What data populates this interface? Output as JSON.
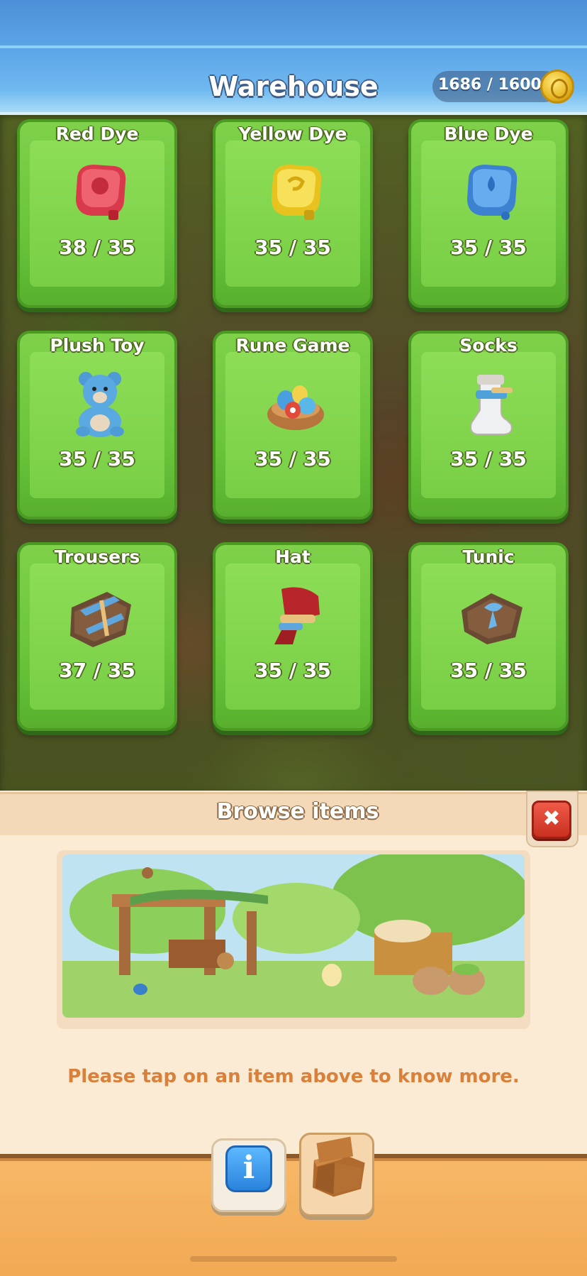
{
  "header": {
    "title": "Warehouse",
    "capacity": "1686 / 16000"
  },
  "items": [
    {
      "name": "Red Dye",
      "count": "38 / 35",
      "icon": "red-dye-icon",
      "color": "#e04a5a"
    },
    {
      "name": "Yellow Dye",
      "count": "35 / 35",
      "icon": "yellow-dye-icon",
      "color": "#f2d232"
    },
    {
      "name": "Blue Dye",
      "count": "35 / 35",
      "icon": "blue-dye-icon",
      "color": "#4a93dd"
    },
    {
      "name": "Plush Toy",
      "count": "35 / 35",
      "icon": "teddy-bear-icon",
      "color": "#5aa9e0"
    },
    {
      "name": "Rune Game",
      "count": "35 / 35",
      "icon": "rune-game-icon",
      "color": "#c98a4d"
    },
    {
      "name": "Socks",
      "count": "35 / 35",
      "icon": "sock-icon",
      "color": "#eef0f2"
    },
    {
      "name": "Trousers",
      "count": "37 / 35",
      "icon": "trousers-icon",
      "color": "#6b4a33"
    },
    {
      "name": "Hat",
      "count": "35 / 35",
      "icon": "hat-icon",
      "color": "#b8262b"
    },
    {
      "name": "Tunic",
      "count": "35 / 35",
      "icon": "tunic-icon",
      "color": "#7a5238"
    }
  ],
  "panel": {
    "title": "Browse items",
    "close_label": "✖",
    "hint": "Please tap on an item above to know more."
  },
  "bottom": {
    "info_label": "i"
  },
  "colors": {
    "card_green": "#6ac53b",
    "header_blue": "#5aa4e6",
    "hint_orange": "#d9803a"
  }
}
